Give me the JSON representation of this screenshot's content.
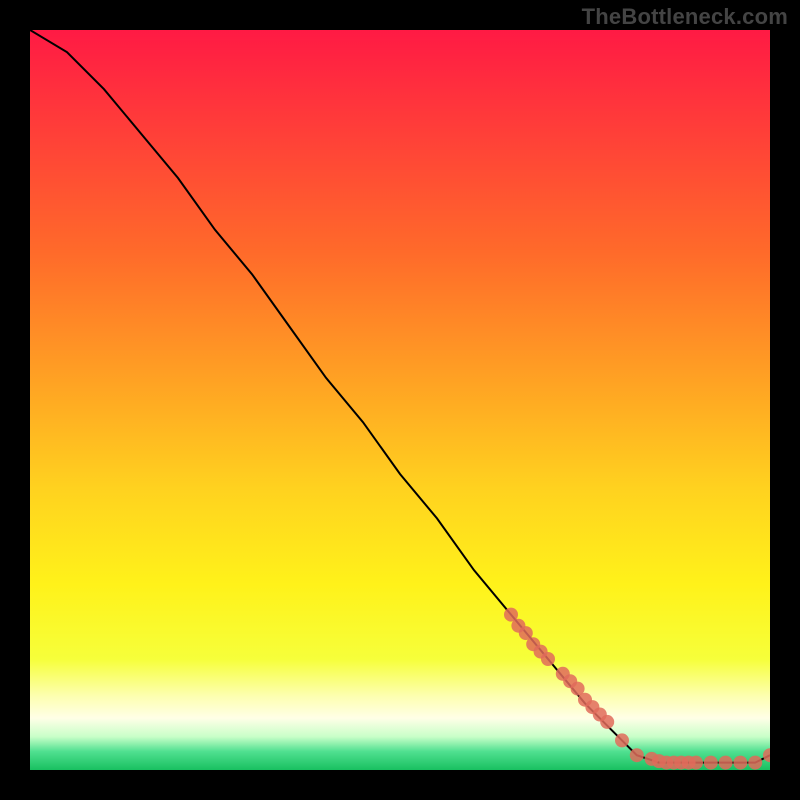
{
  "watermark": "TheBottleneck.com",
  "chart_data": {
    "type": "line",
    "title": "",
    "xlabel": "",
    "ylabel": "",
    "xlim": [
      0,
      100
    ],
    "ylim": [
      0,
      100
    ],
    "grid": false,
    "legend": false,
    "series": [
      {
        "name": "curve",
        "type": "line",
        "color": "#000000",
        "x": [
          0,
          5,
          10,
          15,
          20,
          25,
          30,
          35,
          40,
          45,
          50,
          55,
          60,
          65,
          70,
          75,
          80,
          82,
          85,
          88,
          90,
          92,
          94,
          96,
          98,
          100
        ],
        "y": [
          100,
          97,
          92,
          86,
          80,
          73,
          67,
          60,
          53,
          47,
          40,
          34,
          27,
          21,
          15,
          9,
          4,
          2,
          1,
          1,
          1,
          1,
          1,
          1,
          1,
          2
        ]
      },
      {
        "name": "markers",
        "type": "scatter",
        "color": "#e06b5a",
        "x": [
          65,
          66,
          67,
          68,
          69,
          70,
          72,
          73,
          74,
          75,
          76,
          77,
          78,
          80,
          82,
          84,
          85,
          86,
          87,
          88,
          89,
          90,
          92,
          94,
          96,
          98,
          100
        ],
        "y": [
          21,
          19.5,
          18.5,
          17,
          16,
          15,
          13,
          12,
          11,
          9.5,
          8.5,
          7.5,
          6.5,
          4,
          2,
          1.5,
          1.2,
          1,
          1,
          1,
          1,
          1,
          1,
          1,
          1,
          1,
          2
        ]
      }
    ],
    "gradient_stops": [
      {
        "offset": 0.0,
        "color": "#ff1a44"
      },
      {
        "offset": 0.12,
        "color": "#ff3a3a"
      },
      {
        "offset": 0.3,
        "color": "#ff6a2a"
      },
      {
        "offset": 0.48,
        "color": "#ffa423"
      },
      {
        "offset": 0.62,
        "color": "#ffd21f"
      },
      {
        "offset": 0.75,
        "color": "#fff21a"
      },
      {
        "offset": 0.85,
        "color": "#f6ff3a"
      },
      {
        "offset": 0.9,
        "color": "#fdffb0"
      },
      {
        "offset": 0.93,
        "color": "#ffffe7"
      },
      {
        "offset": 0.955,
        "color": "#c8ffc8"
      },
      {
        "offset": 0.975,
        "color": "#50e090"
      },
      {
        "offset": 1.0,
        "color": "#18c060"
      }
    ]
  }
}
